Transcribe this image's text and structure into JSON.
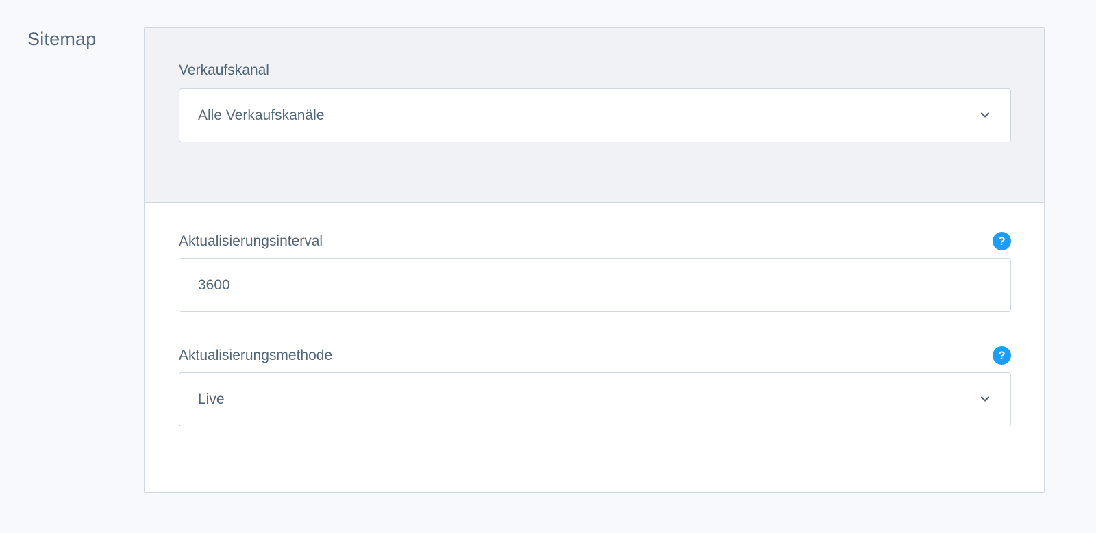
{
  "section": {
    "title": "Sitemap"
  },
  "fields": {
    "sales_channel": {
      "label": "Verkaufskanal",
      "value": "Alle Verkaufskanäle"
    },
    "update_interval": {
      "label": "Aktualisierungsinterval",
      "value": "3600",
      "help": "?"
    },
    "update_method": {
      "label": "Aktualisierungsmethode",
      "value": "Live",
      "help": "?"
    }
  },
  "colors": {
    "text": "#52667a",
    "help_icon": "#189eff",
    "border": "#d1d9e0",
    "header_bg": "#f0f2f5",
    "page_bg": "#f8f9fc"
  },
  "icons": {
    "chevron": "chevron-down-icon",
    "help": "question-circle-icon"
  }
}
